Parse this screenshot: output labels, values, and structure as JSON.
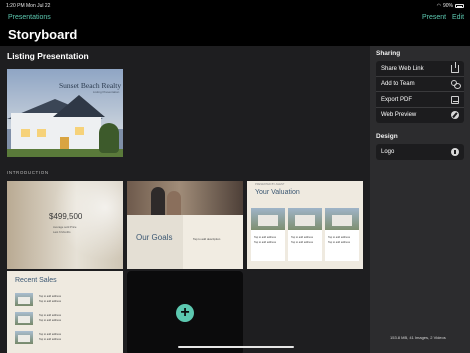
{
  "status_bar": {
    "time": "1:20 PM   Mon Jul 22",
    "battery": "90%"
  },
  "nav": {
    "back_label": "Presentations",
    "present_label": "Present",
    "edit_label": "Edit",
    "title": "Storyboard"
  },
  "main": {
    "section_title": "Listing Presentation",
    "intro_label": "INTRODUCTION",
    "slides": {
      "cover": {
        "brand": "Sunset Beach Realty",
        "sub": "Listing Presentation"
      },
      "price": {
        "price": "$499,500",
        "line1": "Average sold Price",
        "line2": "Last 6 Months"
      },
      "goals": {
        "heading": "Our Goals",
        "tap": "Tap to add description"
      },
      "valuation": {
        "kicker": "PRESENTED BY AGENT",
        "heading": "Your Valuation",
        "cards": [
          {
            "line1": "Tap to add address",
            "line2": "Tap to add address"
          },
          {
            "line1": "Tap to add address",
            "line2": "Tap to add address"
          },
          {
            "line1": "Tap to add address",
            "line2": "Tap to add address"
          }
        ]
      },
      "sales": {
        "heading": "Recent Sales",
        "rows": [
          {
            "line1": "Tap to add address",
            "line2": "Tap to add address"
          },
          {
            "line1": "Tap to add address",
            "line2": "Tap to add address"
          },
          {
            "line1": "Tap to add address",
            "line2": "Tap to add address"
          }
        ]
      },
      "add": {
        "icon": "+"
      }
    }
  },
  "sidebar": {
    "sharing_title": "Sharing",
    "sharing_items": [
      {
        "label": "Share Web Link",
        "icon": "share-icon"
      },
      {
        "label": "Add to Team",
        "icon": "team-icon"
      },
      {
        "label": "Export PDF",
        "icon": "pdf-icon"
      },
      {
        "label": "Web Preview",
        "icon": "compass-icon"
      }
    ],
    "design_title": "Design",
    "design_items": [
      {
        "label": "Logo",
        "icon": "logo-icon"
      }
    ],
    "storage": "153.8 MB, 41 Images, 2 Videos"
  },
  "colors": {
    "accent": "#5cc8b0",
    "sidebar_bg": "#2c2c2e",
    "main_bg": "#1e1e20"
  }
}
